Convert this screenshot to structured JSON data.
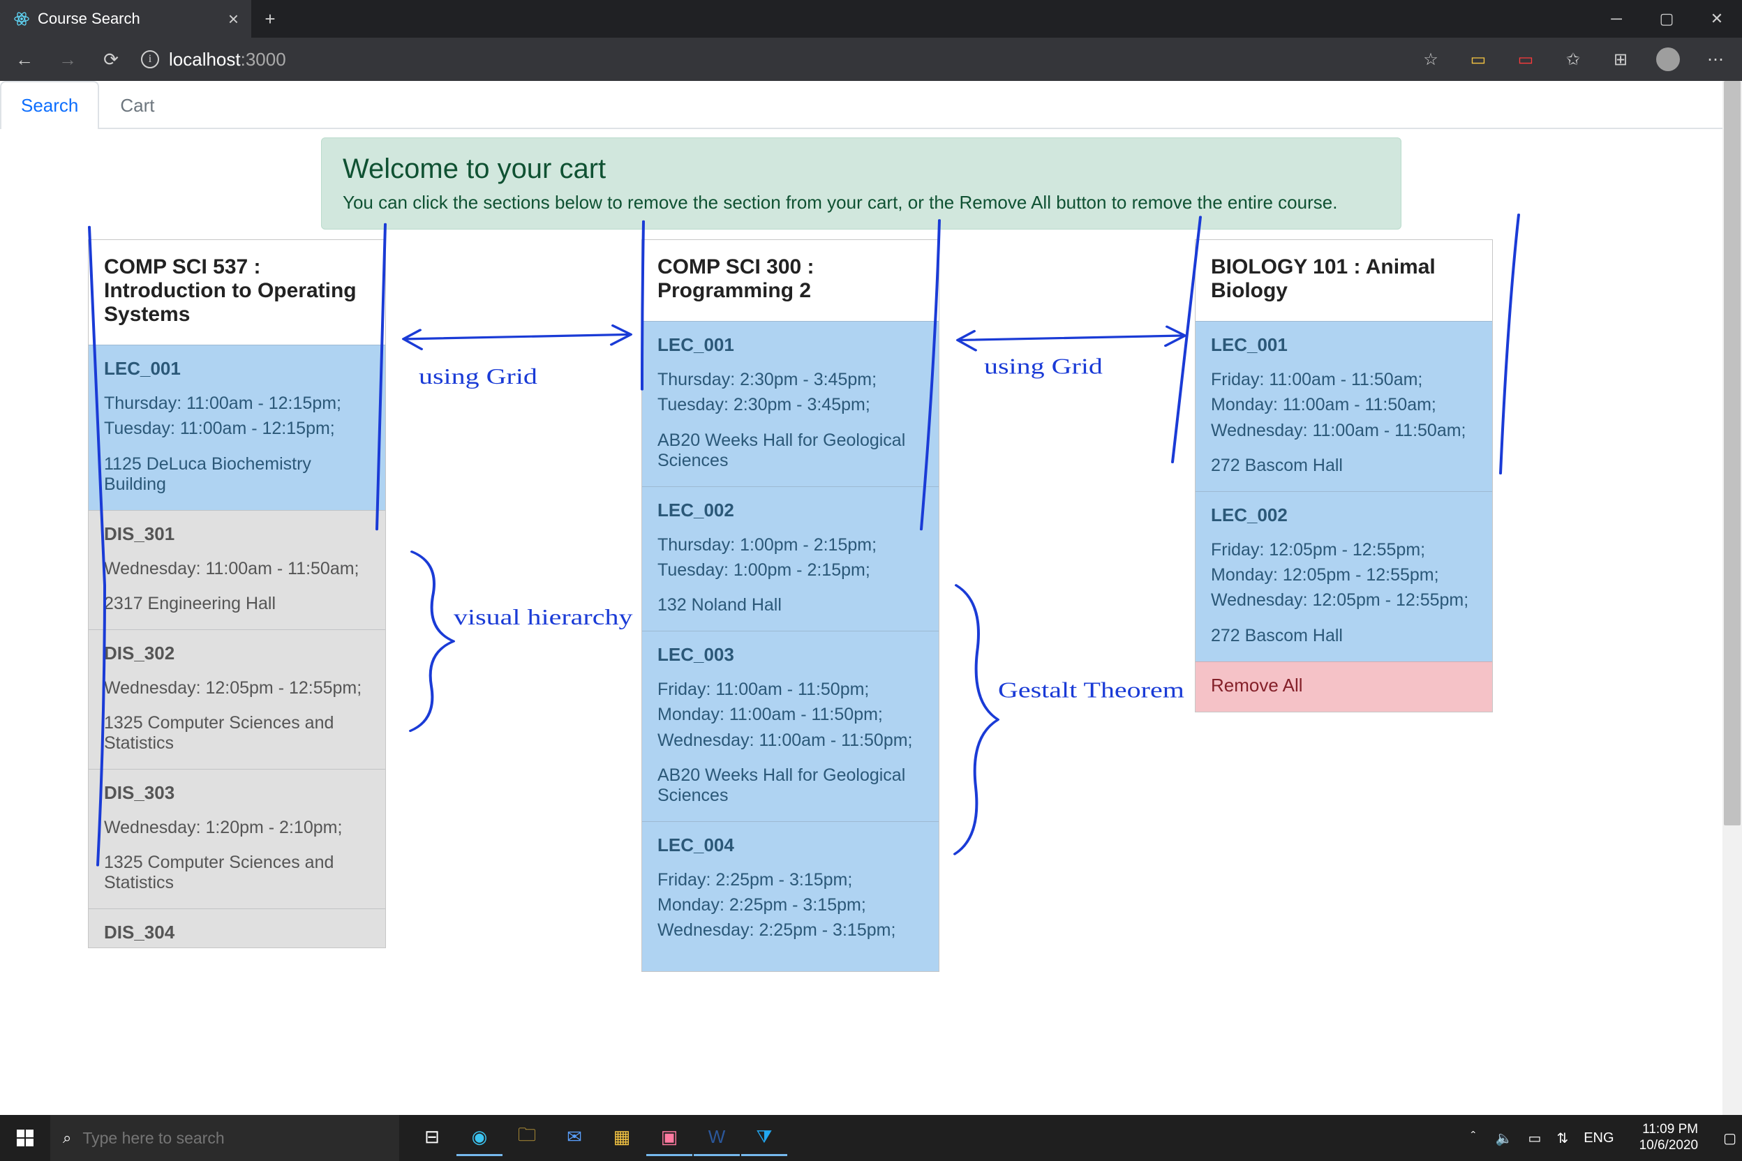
{
  "browser": {
    "tab_title": "Course Search",
    "url_host": "localhost",
    "url_port": ":3000"
  },
  "page": {
    "tabs": {
      "search": "Search",
      "cart": "Cart"
    },
    "alert_title": "Welcome to your cart",
    "alert_body": "You can click the sections below to remove the section from your cart, or the Remove All button to remove the entire course."
  },
  "courses": [
    {
      "title": "COMP SCI 537 : Introduction to Operating Systems",
      "sections": [
        {
          "id": "LEC_001",
          "style": "blue",
          "times": "Thursday: 11:00am - 12:15pm;\nTuesday: 11:00am - 12:15pm;",
          "location": "1125 DeLuca Biochemistry Building"
        },
        {
          "id": "DIS_301",
          "style": "grey",
          "times": "Wednesday: 11:00am - 11:50am;",
          "location": "2317 Engineering Hall"
        },
        {
          "id": "DIS_302",
          "style": "grey",
          "times": "Wednesday: 12:05pm - 12:55pm;",
          "location": "1325 Computer Sciences and Statistics"
        },
        {
          "id": "DIS_303",
          "style": "grey",
          "times": "Wednesday: 1:20pm - 2:10pm;",
          "location": "1325 Computer Sciences and Statistics"
        },
        {
          "id": "DIS_304",
          "style": "grey",
          "times": "",
          "location": ""
        }
      ]
    },
    {
      "title": "COMP SCI 300 : Programming 2",
      "sections": [
        {
          "id": "LEC_001",
          "style": "blue",
          "times": "Thursday: 2:30pm - 3:45pm;\nTuesday: 2:30pm - 3:45pm;",
          "location": "AB20 Weeks Hall for Geological Sciences"
        },
        {
          "id": "LEC_002",
          "style": "blue",
          "times": "Thursday: 1:00pm - 2:15pm;\nTuesday: 1:00pm - 2:15pm;",
          "location": "132 Noland Hall"
        },
        {
          "id": "LEC_003",
          "style": "blue",
          "times": "Friday: 11:00am - 11:50pm;\nMonday: 11:00am - 11:50pm;\nWednesday: 11:00am - 11:50pm;",
          "location": "AB20 Weeks Hall for Geological Sciences"
        },
        {
          "id": "LEC_004",
          "style": "blue",
          "times": "Friday: 2:25pm - 3:15pm; Monday: 2:25pm - 3:15pm; Wednesday: 2:25pm - 3:15pm;",
          "location": ""
        }
      ]
    },
    {
      "title": "BIOLOGY 101 : Animal Biology",
      "sections": [
        {
          "id": "LEC_001",
          "style": "blue",
          "times": "Friday: 11:00am - 11:50am;\nMonday: 11:00am - 11:50am;\nWednesday: 11:00am - 11:50am;",
          "location": "272 Bascom Hall"
        },
        {
          "id": "LEC_002",
          "style": "blue",
          "times": "Friday: 12:05pm - 12:55pm;\nMonday: 12:05pm - 12:55pm;\nWednesday: 12:05pm - 12:55pm;",
          "location": "272 Bascom Hall"
        }
      ],
      "remove_label": "Remove All"
    }
  ],
  "annotations": {
    "grid_left": "using Grid",
    "grid_right": "using Grid",
    "visual": "visual\nhierarchy",
    "gestalt": "Gestalt\nTheorem"
  },
  "taskbar": {
    "search_placeholder": "Type here to search",
    "lang": "ENG",
    "time": "11:09 PM",
    "date": "10/6/2020"
  }
}
